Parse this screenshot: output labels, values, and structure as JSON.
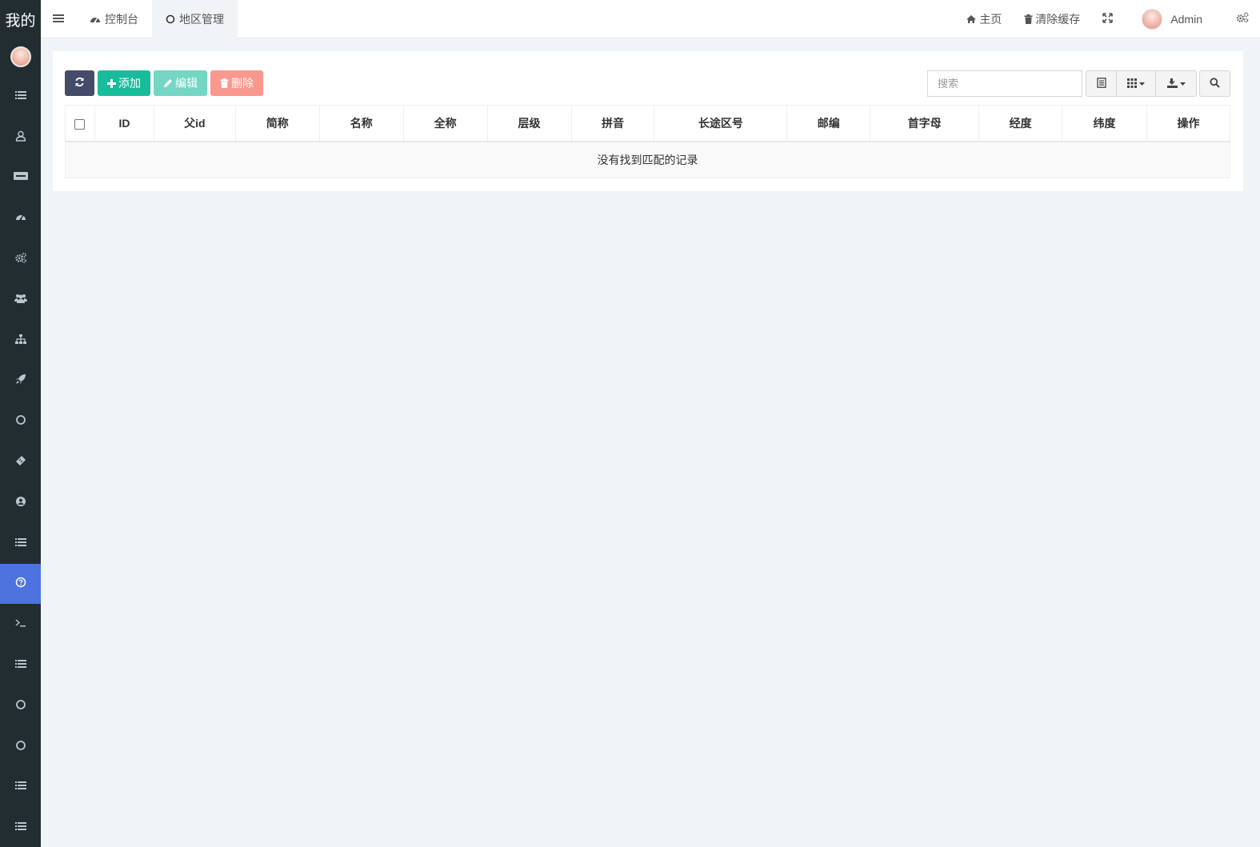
{
  "app": {
    "logo_text": "我的"
  },
  "sidebar": {
    "items": [
      {
        "icon": "list-icon"
      },
      {
        "icon": "user-icon"
      },
      {
        "icon": "paypal-icon"
      },
      {
        "icon": "dashboard-icon"
      },
      {
        "icon": "cogs-icon"
      },
      {
        "icon": "users-icon"
      },
      {
        "icon": "sitemap-icon"
      },
      {
        "icon": "rocket-icon"
      },
      {
        "icon": "circle-icon"
      },
      {
        "icon": "ticket-icon"
      },
      {
        "icon": "user-circle-icon"
      },
      {
        "icon": "list-icon"
      },
      {
        "icon": "question-circle-icon",
        "active": true
      },
      {
        "icon": "terminal-icon"
      },
      {
        "icon": "list-icon"
      },
      {
        "icon": "circle-icon"
      },
      {
        "icon": "circle-icon"
      },
      {
        "icon": "list-icon"
      },
      {
        "icon": "list-icon"
      }
    ]
  },
  "header": {
    "tabs": [
      {
        "label": "控制台",
        "icon": "dashboard-icon"
      },
      {
        "label": "地区管理",
        "icon": "circle-icon",
        "active": true
      }
    ],
    "home_label": "主页",
    "clear_cache_label": "清除缓存",
    "user_name": "Admin"
  },
  "toolbar": {
    "add_label": "添加",
    "edit_label": "编辑",
    "delete_label": "删除",
    "search_placeholder": "搜索"
  },
  "table": {
    "columns": [
      "ID",
      "父id",
      "简称",
      "名称",
      "全称",
      "层级",
      "拼音",
      "长途区号",
      "邮编",
      "首字母",
      "经度",
      "纬度",
      "操作"
    ],
    "empty_text": "没有找到匹配的记录"
  },
  "colors": {
    "sidebar_bg": "#222d32",
    "active_item": "#4e73df",
    "refresh_btn": "#444c69",
    "success": "#18bc9c",
    "danger": "#f75444",
    "page_bg": "#f1f4f6"
  }
}
